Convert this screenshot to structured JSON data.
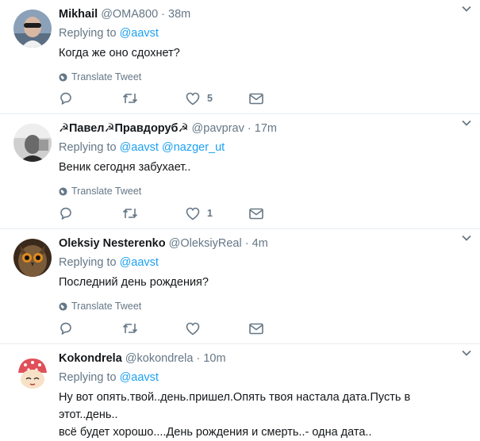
{
  "tweets": [
    {
      "name": "Mikhail",
      "handle": "@OMA800",
      "time": "38m",
      "replying_label": "Replying to",
      "replying_to": [
        "@aavst"
      ],
      "text": "Когда же оно сдохнет?",
      "translate": "Translate Tweet",
      "likes": "5"
    },
    {
      "name": "☭Павел☭Правдоруб☭",
      "handle": "@pavprav",
      "time": "17m",
      "replying_label": "Replying to",
      "replying_to": [
        "@aavst",
        "@nazger_ut"
      ],
      "text": "Веник сегодня забухает..",
      "translate": "Translate Tweet",
      "likes": "1"
    },
    {
      "name": "Oleksiy Nesterenko",
      "handle": "@OleksiyReal",
      "time": "4m",
      "replying_label": "Replying to",
      "replying_to": [
        "@aavst"
      ],
      "text": "Последний день рождения?",
      "translate": "Translate Tweet",
      "likes": ""
    },
    {
      "name": "Kokondrela",
      "handle": "@kokondrela",
      "time": "10m",
      "replying_label": "Replying to",
      "replying_to": [
        "@aavst"
      ],
      "text_line1": "Ну вот опять.твой..день.пришел.Опять твоя настала дата.Пусть в этот..день..",
      "text_line2": "всё будет хорошо....День рождения и смерть..- одна дата.."
    }
  ],
  "separator": "·",
  "colors": {
    "link": "#1da1f2",
    "muted": "#657786",
    "border": "#e6ecf0"
  }
}
